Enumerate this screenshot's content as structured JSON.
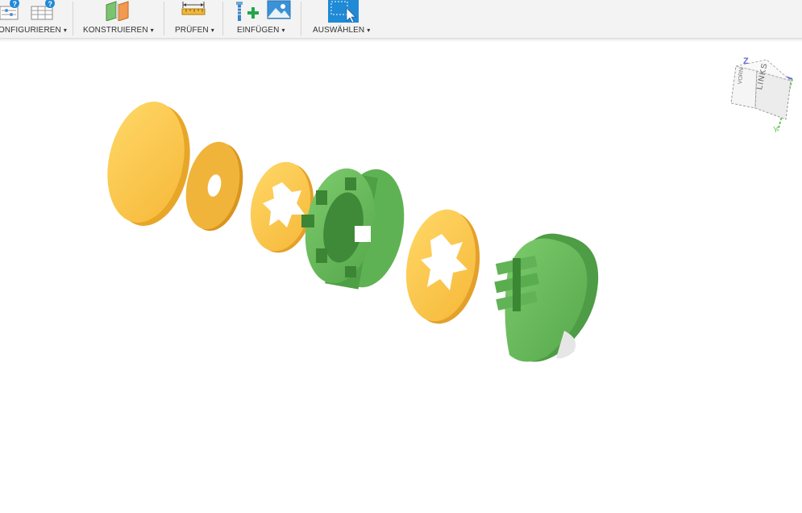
{
  "toolbar": {
    "groups": [
      {
        "label": "ONFIGURIEREN"
      },
      {
        "label": "KONSTRUIEREN"
      },
      {
        "label": "PRÜFEN"
      },
      {
        "label": "EINFÜGEN"
      },
      {
        "label": "AUSWÄHLEN"
      }
    ],
    "caret": "▾"
  },
  "viewcube": {
    "axis_z": "Z",
    "axis_y": "Y",
    "face_left": "LINKS",
    "face_front": "VORN"
  },
  "colors": {
    "part_yellow": "#ffc84a",
    "part_yellow_dark": "#eaa71f",
    "part_green": "#69bf5c",
    "part_green_dark": "#4d9a44",
    "accent_blue": "#1f8ad6"
  }
}
